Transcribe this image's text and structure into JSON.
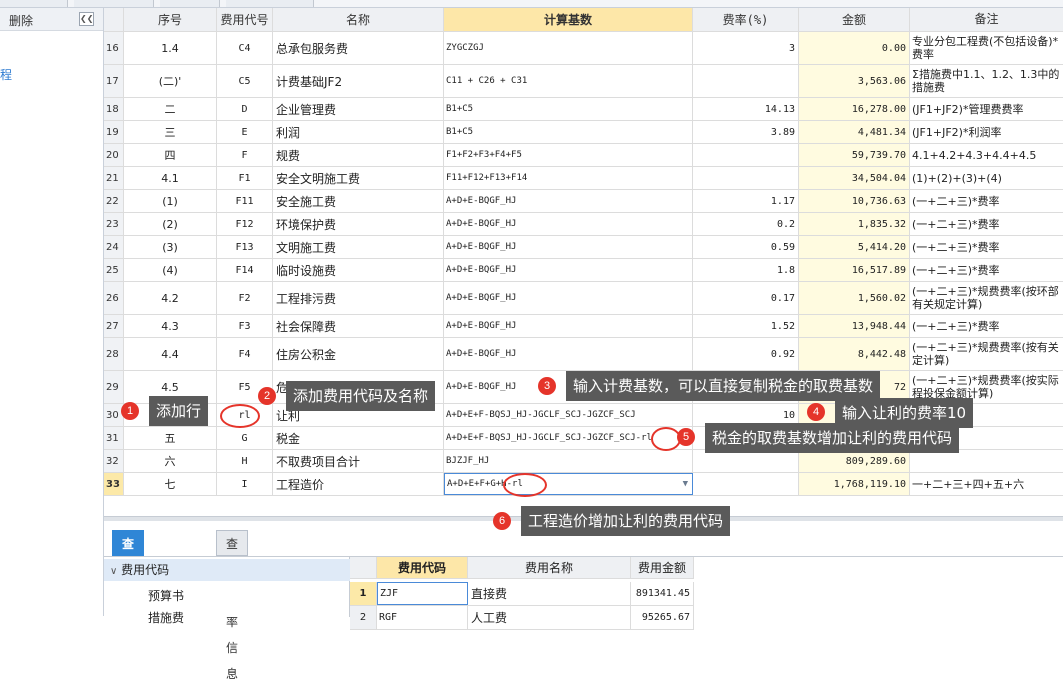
{
  "sidebar": {
    "delete_label": "删除",
    "collapse_icon": "double-chevron-left-icon",
    "link_text": "程"
  },
  "grid": {
    "headers": {
      "no": "",
      "seq": "序号",
      "code": "费用代号",
      "name": "名称",
      "base": "计算基数",
      "rate": "费率(%)",
      "amount": "金额",
      "note": "备注"
    },
    "rows": [
      {
        "no": "16",
        "seq": "1.4",
        "code": "C4",
        "name": "总承包服务费",
        "base": "ZYGCZGJ",
        "rate": "3",
        "amount": "0.00",
        "note": "专业分包工程费(不包括设备)*费率"
      },
      {
        "no": "17",
        "seq": "(二)'",
        "code": "C5",
        "name": "计费基础JF2",
        "base": "C11 + C26 + C31",
        "rate": "",
        "amount": "3,563.06",
        "note": "Σ措施费中1.1、1.2、1.3中的措施费"
      },
      {
        "no": "18",
        "seq": "二",
        "code": "D",
        "name": "企业管理费",
        "base": "B1+C5",
        "rate": "14.13",
        "amount": "16,278.00",
        "note": "(JF1+JF2)*管理费费率"
      },
      {
        "no": "19",
        "seq": "三",
        "code": "E",
        "name": "利润",
        "base": "B1+C5",
        "rate": "3.89",
        "amount": "4,481.34",
        "note": "(JF1+JF2)*利润率"
      },
      {
        "no": "20",
        "seq": "四",
        "code": "F",
        "name": "规费",
        "base": "F1+F2+F3+F4+F5",
        "rate": "",
        "amount": "59,739.70",
        "note": "4.1+4.2+4.3+4.4+4.5"
      },
      {
        "no": "21",
        "seq": "4.1",
        "code": "F1",
        "name": "安全文明施工费",
        "base": "F11+F12+F13+F14",
        "rate": "",
        "amount": "34,504.04",
        "note": "(1)+(2)+(3)+(4)"
      },
      {
        "no": "22",
        "seq": "(1)",
        "code": "F11",
        "name": "安全施工费",
        "base": "A+D+E-BQGF_HJ",
        "rate": "1.17",
        "amount": "10,736.63",
        "note": "(一+二+三)*费率"
      },
      {
        "no": "23",
        "seq": "(2)",
        "code": "F12",
        "name": "环境保护费",
        "base": "A+D+E-BQGF_HJ",
        "rate": "0.2",
        "amount": "1,835.32",
        "note": "(一+二+三)*费率"
      },
      {
        "no": "24",
        "seq": "(3)",
        "code": "F13",
        "name": "文明施工费",
        "base": "A+D+E-BQGF_HJ",
        "rate": "0.59",
        "amount": "5,414.20",
        "note": "(一+二+三)*费率"
      },
      {
        "no": "25",
        "seq": "(4)",
        "code": "F14",
        "name": "临时设施费",
        "base": "A+D+E-BQGF_HJ",
        "rate": "1.8",
        "amount": "16,517.89",
        "note": "(一+二+三)*费率"
      },
      {
        "no": "26",
        "seq": "4.2",
        "code": "F2",
        "name": "工程排污费",
        "base": "A+D+E-BQGF_HJ",
        "rate": "0.17",
        "amount": "1,560.02",
        "note": "(一+二+三)*规费费率(按环部有关规定计算)"
      },
      {
        "no": "27",
        "seq": "4.3",
        "code": "F3",
        "name": "社会保障费",
        "base": "A+D+E-BQGF_HJ",
        "rate": "1.52",
        "amount": "13,948.44",
        "note": "(一+二+三)*费率"
      },
      {
        "no": "28",
        "seq": "4.4",
        "code": "F4",
        "name": "住房公积金",
        "base": "A+D+E-BQGF_HJ",
        "rate": "0.92",
        "amount": "8,442.48",
        "note": "(一+二+三)*规费费率(按有关定计算)"
      },
      {
        "no": "29",
        "seq": "4.5",
        "code": "F5",
        "name": "危险作业意外伤害保险",
        "base": "A+D+E-BQGF_HJ",
        "rate": "",
        "amount": "72",
        "note": "(一+二+三)*规费费率(按实际程投保金额计算)"
      },
      {
        "no": "30",
        "seq": "",
        "code": "rl",
        "name": "让利",
        "base": "A+D+E+F-BQSJ_HJ-JGCLF_SCJ-JGZCF_SCJ",
        "rate": "10",
        "amount": "",
        "note": ""
      },
      {
        "no": "31",
        "seq": "五",
        "code": "G",
        "name": "税金",
        "base": "A+D+E+F-BQSJ_HJ-JGCLF_SCJ-JGZCF_SCJ-rl",
        "rate": "",
        "amount": "",
        "note": "四)*税率"
      },
      {
        "no": "32",
        "seq": "六",
        "code": "H",
        "name": "不取费项目合计",
        "base": "BJZJF_HJ",
        "rate": "",
        "amount": "809,289.60",
        "note": ""
      },
      {
        "no": "33",
        "seq": "七",
        "code": "I",
        "name": "工程造价",
        "base": "A+D+E+F+G+H-rl",
        "rate": "",
        "amount": "1,768,119.10",
        "note": "一+二+三+四+五+六"
      }
    ]
  },
  "annotations": [
    {
      "num": "1",
      "text": "添加行"
    },
    {
      "num": "2",
      "text": "添加费用代码及名称"
    },
    {
      "num": "3",
      "text": "输入计费基数，可以直接复制税金的取费基数"
    },
    {
      "num": "4",
      "text": "输入让利的费率10"
    },
    {
      "num": "5",
      "text": "税金的取费基数增加让利的费用代码"
    },
    {
      "num": "6",
      "text": "工程造价增加让利的费用代码"
    }
  ],
  "bottom": {
    "tabs": [
      "查询费用代码",
      "查询费率信息"
    ],
    "tree": {
      "root": "费用代码",
      "items": [
        "预算书",
        "措施费"
      ]
    },
    "table": {
      "headers": [
        "",
        "费用代码",
        "费用名称",
        "费用金额"
      ],
      "rows": [
        {
          "no": "1",
          "code": "ZJF",
          "name": "直接费",
          "amount": "891341.45"
        },
        {
          "no": "2",
          "code": "RGF",
          "name": "人工费",
          "amount": "95265.67"
        }
      ]
    }
  },
  "colors": {
    "accent": "#2f86d6",
    "badge": "#e5342a",
    "callout_bg": "#5a5a5a",
    "amount_bg": "#fffbe0",
    "header_highlight": "#fde7a8"
  }
}
